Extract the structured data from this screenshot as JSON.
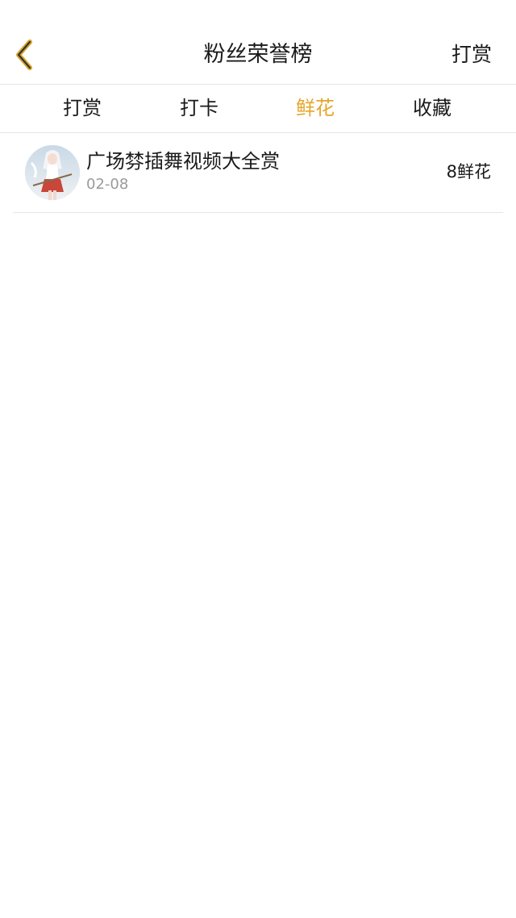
{
  "nav": {
    "title": "粉丝荣誉榜",
    "action_label": "打赏",
    "accent_color": "#e5a62a"
  },
  "tabs": [
    {
      "label": "打赏",
      "active": false
    },
    {
      "label": "打卡",
      "active": false
    },
    {
      "label": "鲜花",
      "active": true
    },
    {
      "label": "收藏",
      "active": false
    }
  ],
  "list": {
    "items": [
      {
        "title": "广场棼插舞视频大全赏",
        "date": "02-08",
        "value": "8鲜花",
        "avatar_icon": "anime-character-avatar"
      }
    ]
  }
}
